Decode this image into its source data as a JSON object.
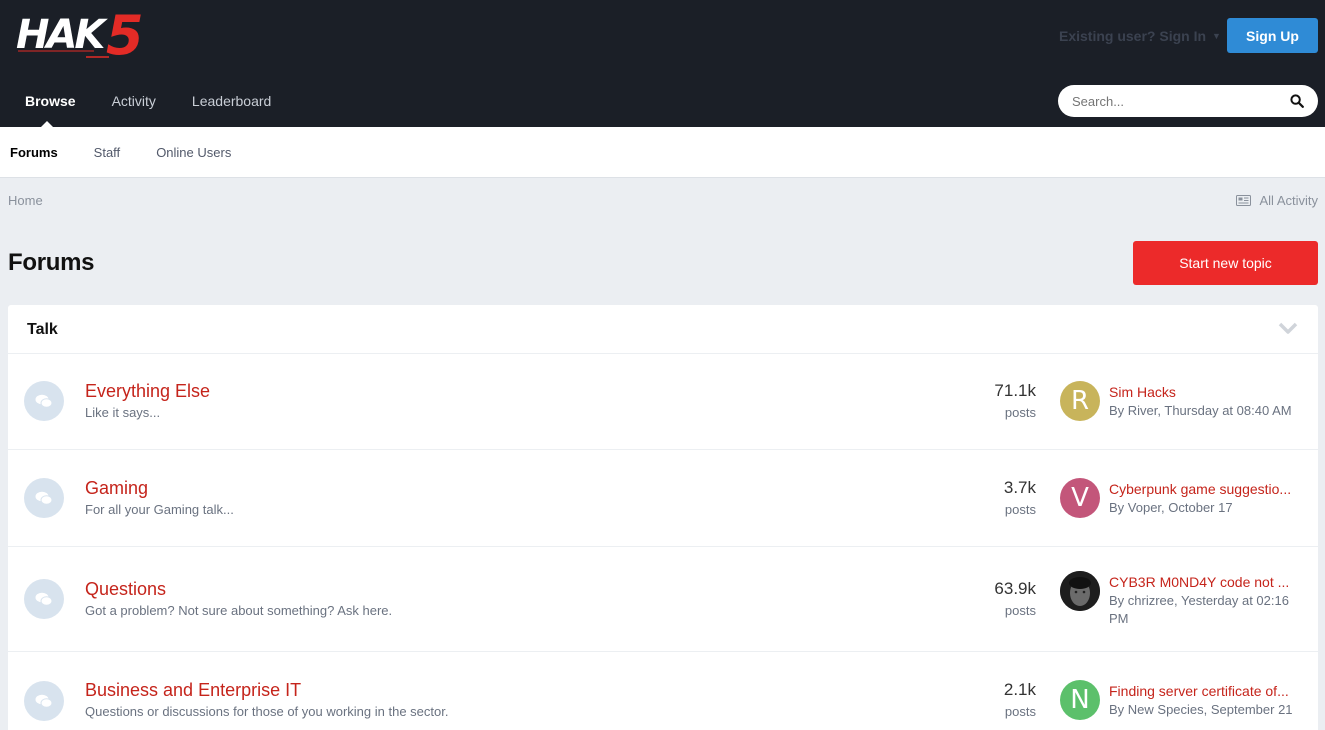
{
  "header": {
    "logo_text": "HAK5",
    "signin_label": "Existing user? Sign In",
    "signup_label": "Sign Up",
    "nav": [
      "Browse",
      "Activity",
      "Leaderboard"
    ],
    "search_placeholder": "Search..."
  },
  "subnav": [
    "Forums",
    "Staff",
    "Online Users"
  ],
  "breadcrumb": "Home",
  "all_activity": "All Activity",
  "page_title": "Forums",
  "start_topic_label": "Start new topic",
  "category": {
    "title": "Talk",
    "forums": [
      {
        "name": "Everything Else",
        "description": "Like it says...",
        "count": "71.1k",
        "count_label": "posts",
        "avatar_letter": "R",
        "avatar_color": "#c8b45b",
        "last_title": "Sim Hacks",
        "last_by": "By River, Thursday at 08:40 AM"
      },
      {
        "name": "Gaming",
        "description": "For all your Gaming talk...",
        "count": "3.7k",
        "count_label": "posts",
        "avatar_letter": "V",
        "avatar_color": "#c3567a",
        "last_title": "Cyberpunk game suggestio...",
        "last_by": "By Voper, October 17"
      },
      {
        "name": "Questions",
        "description": "Got a problem? Not sure about something? Ask here.",
        "count": "63.9k",
        "count_label": "posts",
        "avatar_letter": "",
        "avatar_color": "#2a2a2a",
        "last_title": "CYB3R M0ND4Y code not ...",
        "last_by": "By chrizree, Yesterday at 02:16 PM"
      },
      {
        "name": "Business and Enterprise IT",
        "description": "Questions or discussions for those of you working in the sector.",
        "count": "2.1k",
        "count_label": "posts",
        "avatar_letter": "N",
        "avatar_color": "#5cc06b",
        "last_title": "Finding server certificate of...",
        "last_by": "By New Species, September 21"
      }
    ]
  }
}
